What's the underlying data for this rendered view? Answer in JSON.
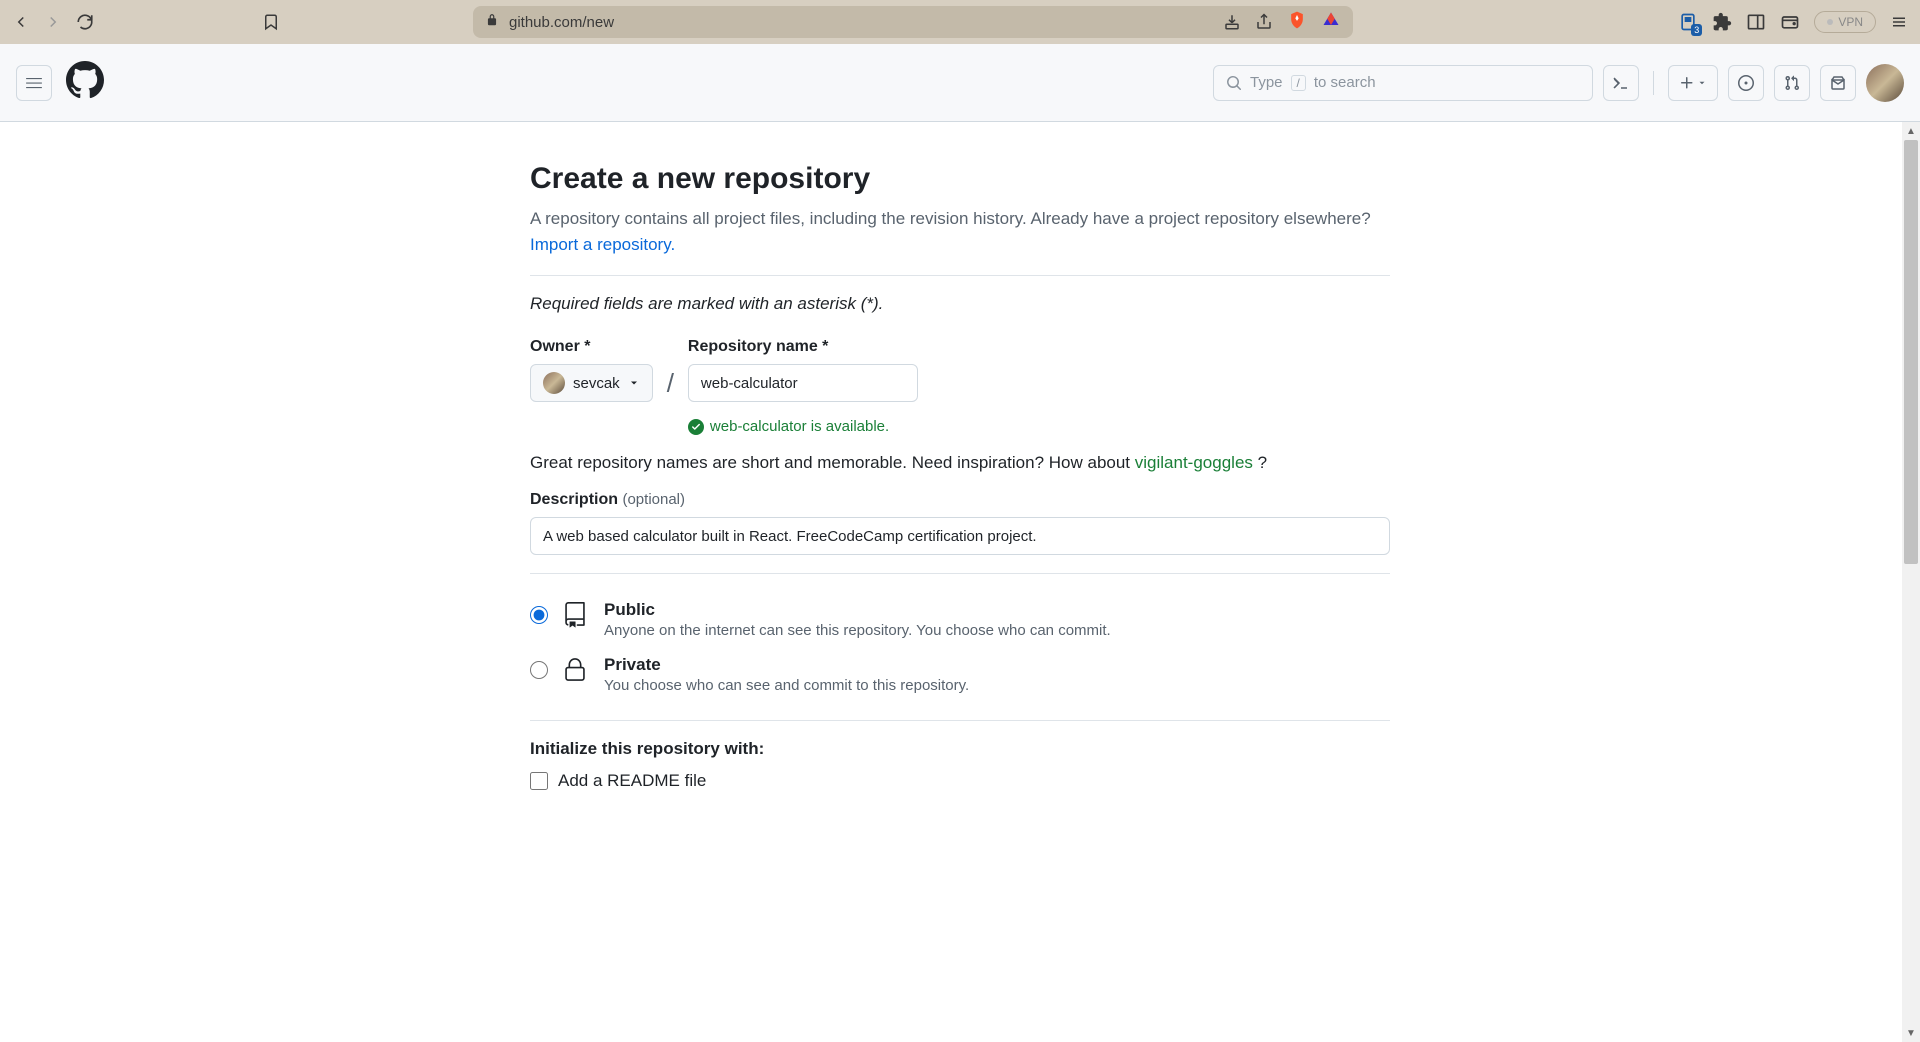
{
  "browser": {
    "url": "github.com/new",
    "vpn_label": "VPN",
    "ext_badge": "3"
  },
  "header": {
    "search_prefix": "Type",
    "search_slash": "/",
    "search_suffix": "to search"
  },
  "page": {
    "title": "Create a new repository",
    "subtitle_part1": "A repository contains all project files, including the revision history. Already have a project repository elsewhere? ",
    "import_link": "Import a repository.",
    "required_note": "Required fields are marked with an asterisk (*).",
    "owner_label": "Owner *",
    "owner_value": "sevcak",
    "reponame_label": "Repository name *",
    "reponame_value": "web-calculator",
    "availability": "web-calculator is available.",
    "inspiration_part1": "Great repository names are short and memorable. Need inspiration? How about ",
    "inspiration_suggestion": "vigilant-goggles",
    "inspiration_part2": " ?",
    "description_label": "Description",
    "description_optional": "(optional)",
    "description_value": "A web based calculator built in React. FreeCodeCamp certification project.",
    "visibility": {
      "public_title": "Public",
      "public_desc": "Anyone on the internet can see this repository. You choose who can commit.",
      "private_title": "Private",
      "private_desc": "You choose who can see and commit to this repository."
    },
    "init_title": "Initialize this repository with:",
    "readme_label": "Add a README file"
  }
}
